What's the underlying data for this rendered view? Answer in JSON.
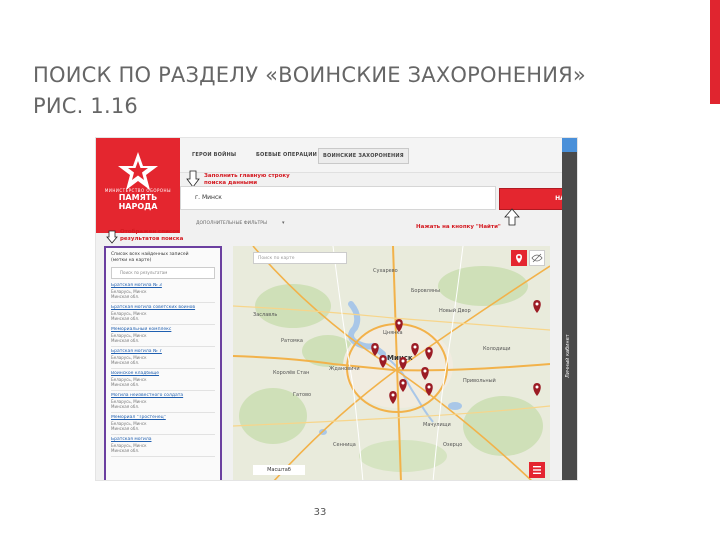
{
  "slide": {
    "title_line1": "ПОИСК ПО РАЗДЕЛУ «ВОИНСКИЕ ЗАХОРОНЕНИЯ»",
    "title_line2": "РИС. 1.16",
    "page_number": "33",
    "accent_color": "#e0252f"
  },
  "site": {
    "logo_top": "МИНИСТЕРСТВО ОБОРОНЫ",
    "logo_line1": "ПАМЯТЬ",
    "logo_line2": "НАРОДА",
    "brand_color": "#e4262f",
    "nav": [
      "ГЕРОИ ВОЙНЫ",
      "БОЕВЫЕ ОПЕРАЦИИ",
      "ВОИНСКИЕ ЗАХОРОНЕНИЯ"
    ],
    "nav_active": "ВОИНСКИЕ ЗАХОРОНЕНИЯ",
    "search_value": "г. Минск",
    "search_button": "НАЙТИ",
    "filter_link": "ДОПОЛНИТЕЛЬНЫЕ ФИЛЬТРЫ",
    "sidebar_label": "Личный кабинет"
  },
  "annotations": {
    "fill_line1": "Заполнить главную строку",
    "fill_line2": "поиска данными",
    "press": "Нажать на кнопку \"Найти\"",
    "shown_line1": "Отображен список",
    "shown_line2": "результатов поиска",
    "color": "#d41a21"
  },
  "results": {
    "header_line1": "Список всех найденных записей",
    "header_line2": "(метки на карте)",
    "search_placeholder": "Поиск по результатам",
    "items": [
      {
        "title": "Братская могила № 3",
        "line1": "Беларусь, Минск",
        "line2": "Минская обл."
      },
      {
        "title": "Братская могила советских воинов",
        "line1": "Беларусь, Минск",
        "line2": "Минская обл."
      },
      {
        "title": "Мемориальный комплекс",
        "line1": "Беларусь, Минск",
        "line2": "Минская обл."
      },
      {
        "title": "Братская могила № 7",
        "line1": "Беларусь, Минск",
        "line2": "Минская обл."
      },
      {
        "title": "Воинское кладбище",
        "line1": "Беларусь, Минск",
        "line2": "Минская обл."
      },
      {
        "title": "Могила неизвестного солдата",
        "line1": "Беларусь, Минск",
        "line2": "Минская обл."
      },
      {
        "title": "Мемориал \"Тростенец\"",
        "line1": "Беларусь, Минск",
        "line2": "Минская обл."
      },
      {
        "title": "Братская могила",
        "line1": "Беларусь, Минск",
        "line2": "Минская обл."
      }
    ]
  },
  "map": {
    "search_placeholder": "Поиск по карте",
    "scale_text": "Масштаб",
    "city": "Минск",
    "places": [
      "Сухарево",
      "Колодищи",
      "Боровляны",
      "Заславль",
      "Ратомка",
      "Новый Двор",
      "Мачулищи",
      "Гатово",
      "Сенница",
      "Привольный",
      "Цнянка",
      "Ждановичи",
      "Королёв Стан",
      "Озерцо"
    ],
    "marker_color": "#9b1b24"
  }
}
